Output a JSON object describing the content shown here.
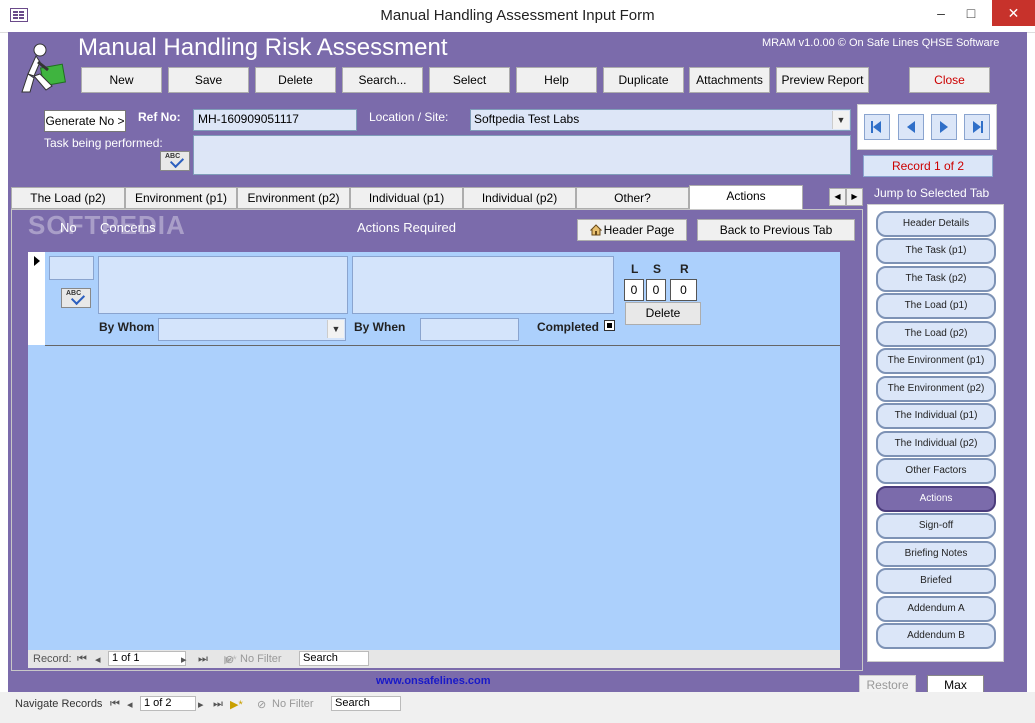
{
  "window": {
    "title": "Manual Handling Assessment Input Form",
    "minimize": "–",
    "maximize": "□",
    "close": "✕"
  },
  "header": {
    "app_title": "Manual Handling Risk Assessment",
    "version": "MRAM v1.0.00 © On Safe Lines QHSE Software",
    "logo_icon": "person-lifting-box-icon"
  },
  "toolbar": {
    "new": "New",
    "save": "Save",
    "delete": "Delete",
    "search": "Search...",
    "select": "Select",
    "help": "Help",
    "duplicate": "Duplicate",
    "attachments": "Attachments",
    "preview_report": "Preview Report",
    "close": "Close"
  },
  "form": {
    "generate_no": "Generate No >",
    "ref_no_label": "Ref No:",
    "ref_no_value": "MH-160909051117",
    "location_label": "Location / Site:",
    "location_value": "Softpedia Test Labs",
    "task_label": "Task being performed:",
    "task_value": "",
    "spell_label": "ABC"
  },
  "record_nav": {
    "record_text": "Record 1 of 2"
  },
  "tabs": [
    {
      "label": "The Load (p2)"
    },
    {
      "label": "Environment (p1)"
    },
    {
      "label": "Environment (p2)"
    },
    {
      "label": "Individual (p1)"
    },
    {
      "label": "Individual (p2)"
    },
    {
      "label": "Other?"
    },
    {
      "label": "Actions"
    }
  ],
  "actions_tab": {
    "watermark": "SOFTPEDIA",
    "col_no": "No",
    "col_concerns": "Concerns",
    "col_actions": "Actions Required",
    "header_page_btn": "Header Page",
    "back_btn": "Back to Previous Tab",
    "by_whom_label": "By Whom",
    "by_when_label": "By When",
    "completed_label": "Completed",
    "l_label": "L",
    "s_label": "S",
    "r_label": "R",
    "l_value": "0",
    "s_value": "0",
    "r_value": "0",
    "delete_btn": "Delete"
  },
  "subform_nav": {
    "record_label": "Record:",
    "record_value": "1 of 1",
    "filter": "No Filter",
    "search": "Search"
  },
  "website": "www.onsafelines.com",
  "sidebar": {
    "title": "Jump to Selected Tab",
    "items": [
      {
        "label": "Header Details"
      },
      {
        "label": "The Task (p1)"
      },
      {
        "label": "The Task (p2)"
      },
      {
        "label": "The Load (p1)"
      },
      {
        "label": "The Load (p2)"
      },
      {
        "label": "The Environment (p1)"
      },
      {
        "label": "The Environment (p2)"
      },
      {
        "label": "The Individual (p1)"
      },
      {
        "label": "The Individual (p2)"
      },
      {
        "label": "Other Factors"
      },
      {
        "label": "Actions"
      },
      {
        "label": "Sign-off"
      },
      {
        "label": "Briefing Notes"
      },
      {
        "label": "Briefed"
      },
      {
        "label": "Addendum A"
      },
      {
        "label": "Addendum B"
      }
    ],
    "restore": "Restore",
    "max": "Max"
  },
  "bottom_nav": {
    "label": "Navigate Records",
    "record_value": "1 of 2",
    "filter": "No Filter",
    "search": "Search"
  },
  "colors": {
    "form_background": "#7b6bab",
    "subform_background": "#acd0fc",
    "close_accent": "#cc0000",
    "link": "#1919c8"
  }
}
